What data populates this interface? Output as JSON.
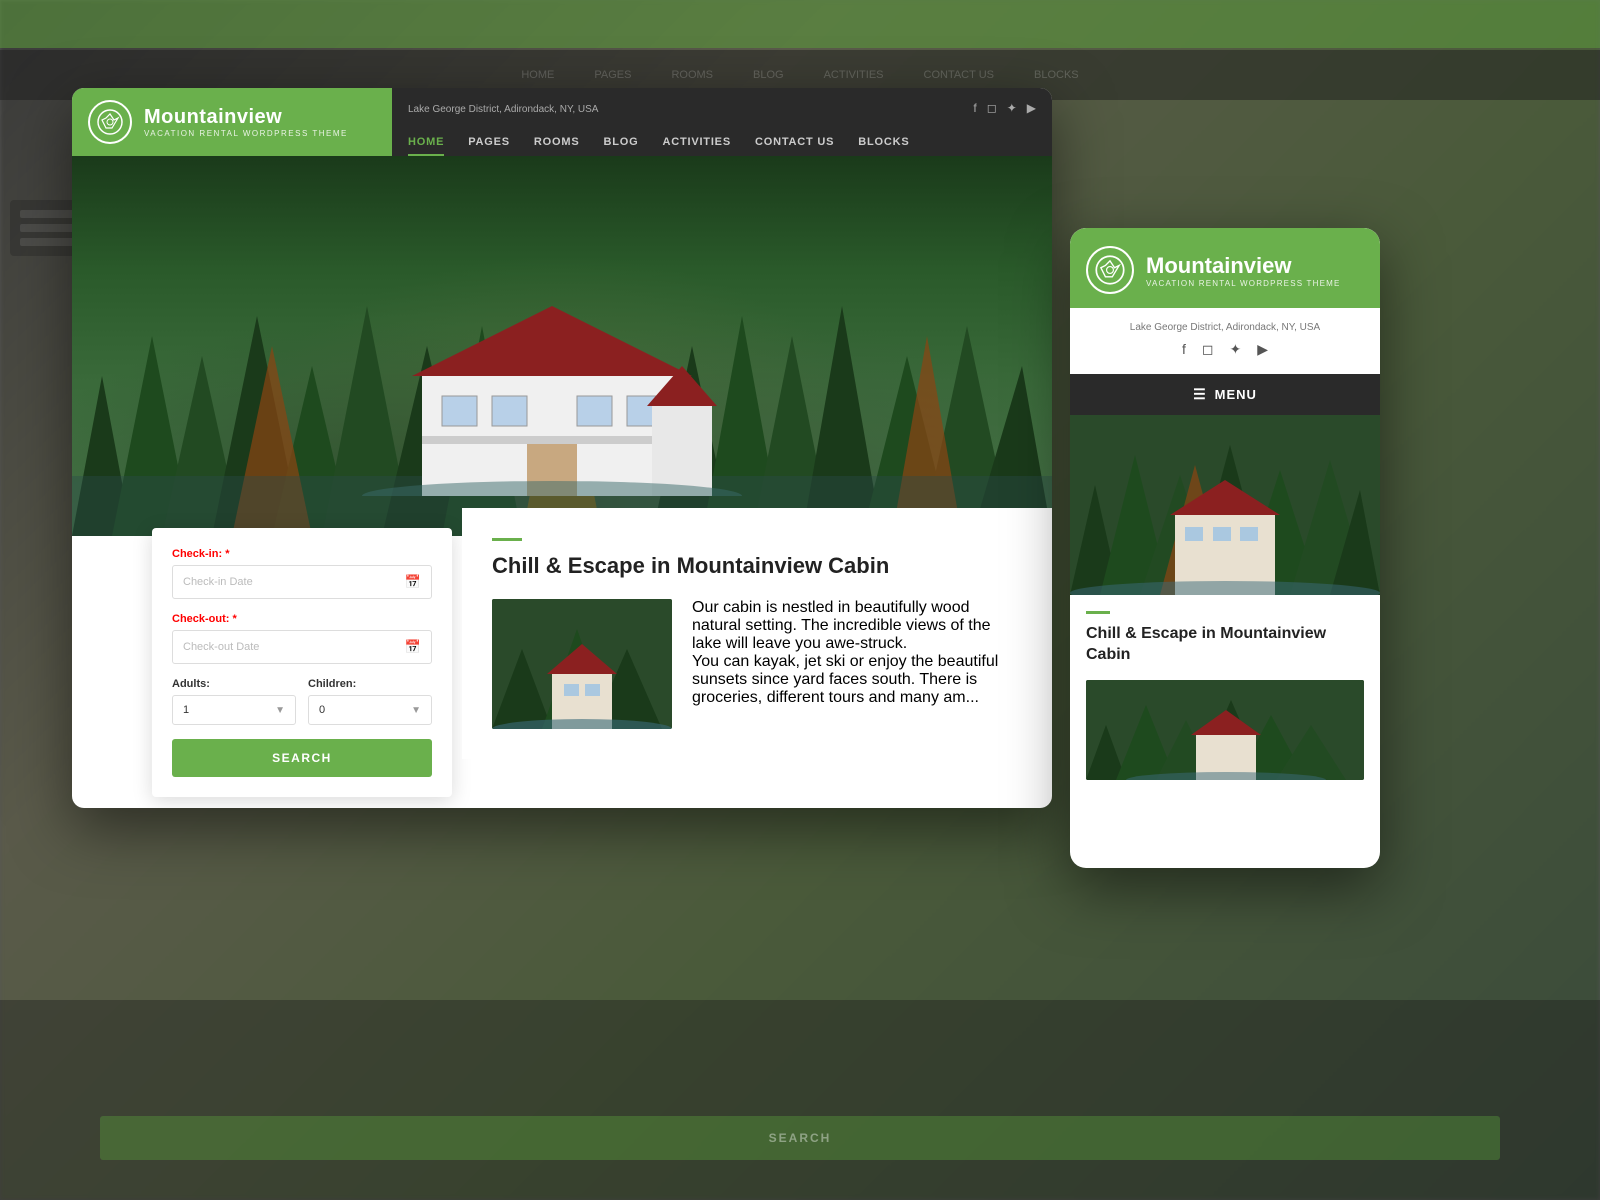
{
  "brand": {
    "name": "Mountainview",
    "tagline": "VACATION RENTAL WORDPRESS THEME"
  },
  "location": "Lake George District, Adirondack, NY, USA",
  "nav": {
    "links": [
      "HOME",
      "PAGES",
      "ROOMS",
      "BLOG",
      "ACTIVITIES",
      "CONTACT US",
      "BLOCKS"
    ],
    "active": "HOME"
  },
  "mobile_nav": {
    "menu_label": "MENU"
  },
  "booking": {
    "checkin_label": "Check-in:",
    "checkin_placeholder": "Check-in Date",
    "checkout_label": "Check-out:",
    "checkout_placeholder": "Check-out Date",
    "adults_label": "Adults:",
    "adults_value": "1",
    "children_label": "Children:",
    "children_value": "0",
    "search_btn": "SEARCH"
  },
  "content": {
    "title": "Chill & Escape in Mountainview Cabin",
    "paragraph1": "Our cabin is nestled in beautifully wood natural setting. The incredible views of the lake will leave you awe-struck.",
    "paragraph2": "You can kayak, jet ski or enjoy the beautiful sunsets since yard faces south. There is groceries, different tours and many am..."
  },
  "mobile_content": {
    "title": "Chill & Escape in Mountainview Cabin"
  },
  "social": {
    "facebook": "f",
    "instagram": "◻",
    "twitter": "✦",
    "youtube": "▶"
  },
  "colors": {
    "green": "#6ab04c",
    "dark": "#2a2a2a",
    "light": "#ffffff"
  }
}
